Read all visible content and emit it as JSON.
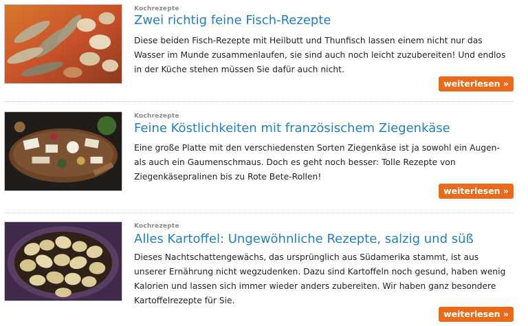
{
  "articles": [
    {
      "category": "Kochrezepte",
      "title": "Zwei richtig feine Fisch-Rezepte",
      "teaser": "Diese beiden Fisch-Rezepte mit Heilbutt und Thunfisch lassen einem nicht nur das Wasser im Munde zusammenlaufen, sie sind auch noch leicht zuzubereiten! Und endlos in der Küche stehen müssen Sie dafür auch nicht.",
      "button": "weiterlesen »",
      "image": "fish-photo"
    },
    {
      "category": "Kochrezepte",
      "title": "Feine Köstlichkeiten mit französischem Ziegenkäse",
      "teaser": "Eine große Platte mit den verschiedensten Sorten Ziegenkäse ist ja sowohl ein Augen- als auch ein Gaumenschmaus. Doch es geht noch besser: Tolle Rezepte von Ziegenkäsepralinen bis zu Rote Bete-Rollen!",
      "button": "weiterlesen »",
      "image": "cheese-platter-photo"
    },
    {
      "category": "Kochrezepte",
      "title": "Alles Kartoffel: Ungewöhnliche Rezepte, salzig und süß",
      "teaser": "Dieses Nachtschattengewächs, das ursprünglich aus Südamerika stammt, ist aus unserer Ernährung nicht wegzudenken. Dazu sind Kartoffeln noch gesund, haben wenig Kalorien und lassen sich immer wieder anders zubereiten. Wir haben ganz besondere Kartoffelrezepte für Sie.",
      "button": "weiterlesen »",
      "image": "potato-basket-photo"
    }
  ],
  "colors": {
    "title_link": "#1f7fc1",
    "button_bg": "#ea6a1a",
    "category_text": "#8a8a8a"
  }
}
